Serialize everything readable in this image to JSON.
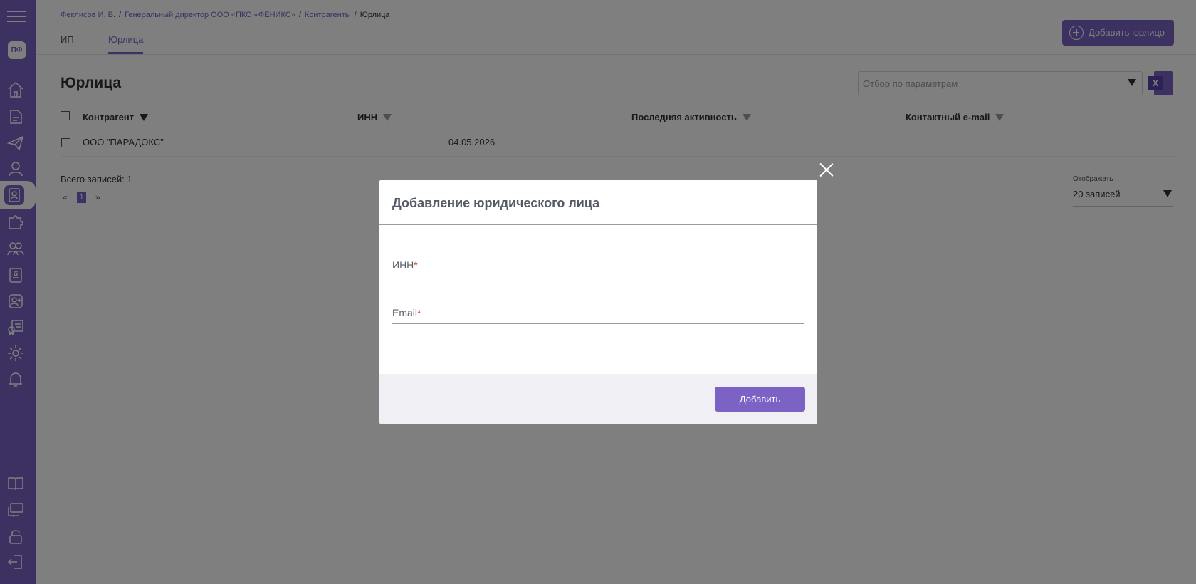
{
  "sidebar": {
    "avatar": "ПФ"
  },
  "breadcrumb": {
    "items": [
      "Феклисов И. В.",
      "Генеральный директор ООО «ПКО «ФЕНИКС»",
      "Контрагенты"
    ],
    "current": "Юрлица",
    "separator": "/"
  },
  "tabs": [
    {
      "label": "ИП",
      "active": false
    },
    {
      "label": "Юрлица",
      "active": true
    }
  ],
  "header": {
    "add_button": "Добавить юрлицо"
  },
  "page": {
    "title": "Юрлица",
    "filter_placeholder": "Отбор по параметрам",
    "export_label": "X"
  },
  "table": {
    "columns": [
      "Контрагент",
      "ИНН",
      "Последняя активность",
      "Контактный e-mail"
    ],
    "rows": [
      {
        "name": "ООО \"ПАРАДОКС\"",
        "date": "04.05.2026"
      }
    ]
  },
  "footer": {
    "total": "Всего записей: 1",
    "prev": "«",
    "page": "1",
    "next": "»",
    "show_label": "Отображать",
    "show_value": "20 записей"
  },
  "modal": {
    "title": "Добавление юридического лица",
    "fields": [
      {
        "label": "ИНН",
        "required_mark": "*"
      },
      {
        "label": "Email",
        "required_mark": "*"
      }
    ],
    "submit": "Добавить"
  },
  "colors": {
    "accent": "#7b62c4",
    "overlay": "rgba(0,0,0,0.5)",
    "required": "#d93a3a"
  }
}
